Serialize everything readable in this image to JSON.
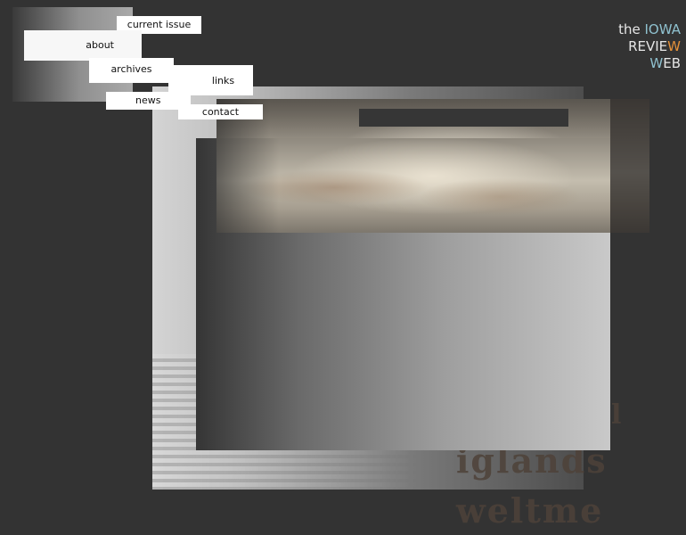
{
  "nav": {
    "items": [
      {
        "label": "current issue"
      },
      {
        "label": "about"
      },
      {
        "label": "archives"
      },
      {
        "label": "links"
      },
      {
        "label": "news"
      },
      {
        "label": "contact"
      }
    ]
  },
  "logo": {
    "line1_prefix": "the ",
    "line1_accent": "IOWA",
    "line2_main": "REVIE",
    "line2_accent": "W",
    "line3_accent": "W",
    "line3_main": "EB"
  },
  "background_text": {
    "line1": "l",
    "line2": "iglands",
    "line3": "weltme"
  },
  "colors": {
    "background": "#333333",
    "logo_blue": "#8fc1cf",
    "logo_orange": "#e5913a",
    "nav_item": "#ffffff"
  }
}
